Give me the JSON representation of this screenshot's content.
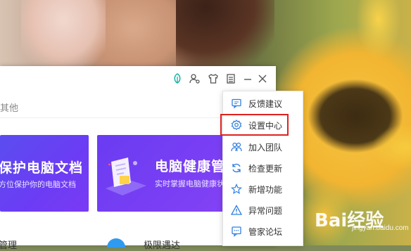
{
  "app": {
    "nav_tab_label": "其他",
    "cards": [
      {
        "title": "保护电脑文档",
        "subtitle": "方位保护你的电脑文档"
      },
      {
        "title": "电脑健康管理",
        "subtitle": "实时掌握电脑健康状"
      }
    ],
    "bottom_items": [
      "管理",
      "极限遇达"
    ]
  },
  "titlebar_icons": [
    "leaf-icon",
    "user-settings-icon",
    "tshirt-icon",
    "menu-list-icon",
    "minimize-icon",
    "close-icon"
  ],
  "menu": {
    "items": [
      {
        "label": "反馈建议",
        "icon": "message-icon"
      },
      {
        "label": "设置中心",
        "icon": "gear-icon"
      },
      {
        "label": "加入团队",
        "icon": "team-icon"
      },
      {
        "label": "检查更新",
        "icon": "refresh-icon"
      },
      {
        "label": "新增功能",
        "icon": "star-icon"
      },
      {
        "label": "异常问题",
        "icon": "warning-icon"
      },
      {
        "label": "管家论坛",
        "icon": "forum-icon"
      }
    ],
    "highlighted": "设置中心"
  },
  "watermark": {
    "logo": "Bai经验",
    "sub": "jingyan.baidu.com"
  },
  "colors": {
    "accent": "#2f7fe0",
    "card_purple": "#6c3cf4",
    "highlight": "#e0201f",
    "leaf_green": "#17b3a6"
  }
}
